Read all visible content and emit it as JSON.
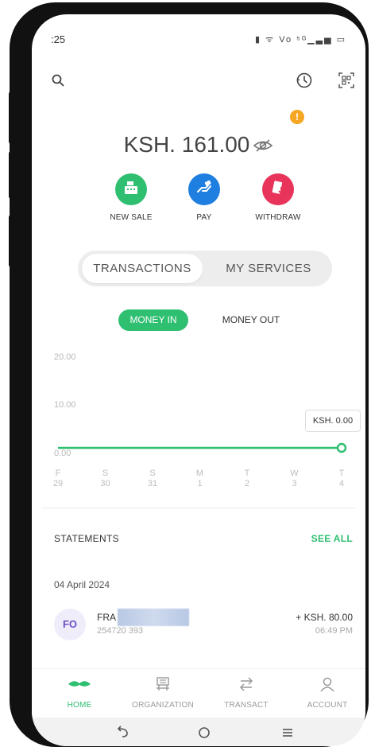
{
  "status_bar": {
    "time": ":25",
    "icons": "▮ ᯤ Vo ⁵ᴳ▁▃▅ ▭"
  },
  "header": {
    "search_icon": "search-icon",
    "history_icon": "history-icon",
    "scan_icon": "qr-scan-icon",
    "alert_glyph": "!"
  },
  "balance": {
    "amount": "KSH. 161.00",
    "visibility_icon": "eye-off-icon"
  },
  "actions": [
    {
      "label": "NEW SALE",
      "icon": "cash-register-icon",
      "color": "#2fbf71"
    },
    {
      "label": "PAY",
      "icon": "pay-hand-icon",
      "color": "#1f7fe0"
    },
    {
      "label": "WITHDRAW",
      "icon": "withdraw-icon",
      "color": "#e8345a"
    }
  ],
  "segment": {
    "tabs": [
      "TRANSACTIONS",
      "MY SERVICES"
    ],
    "active": "TRANSACTIONS"
  },
  "filter": {
    "options": [
      "MONEY IN",
      "MONEY OUT"
    ],
    "active": "MONEY IN"
  },
  "chart_data": {
    "type": "line",
    "categories": [
      "F 29",
      "S 30",
      "S 31",
      "M 1",
      "T 2",
      "W 3",
      "T 4"
    ],
    "day_letters": [
      "F",
      "S",
      "S",
      "M",
      "T",
      "W",
      "T"
    ],
    "day_numbers": [
      "29",
      "30",
      "31",
      "1",
      "2",
      "3",
      "4"
    ],
    "values": [
      0,
      0,
      0,
      0,
      0,
      0,
      0
    ],
    "y_ticks": [
      "20.00",
      "10.00",
      "0.00"
    ],
    "ylim": [
      0,
      20
    ],
    "grid": false,
    "tooltip": "KSH. 0.00",
    "line_color": "#2fbf71"
  },
  "statements": {
    "title": "STATEMENTS",
    "see_all": "SEE ALL",
    "date": "04 April 2024",
    "items": [
      {
        "initials": "FO",
        "name": "FRA",
        "sub": "254720   393",
        "amount": "+ KSH. 80.00",
        "time": "06:49 PM"
      }
    ]
  },
  "bottom_nav": [
    {
      "label": "HOME",
      "icon": "home-icon",
      "active": true
    },
    {
      "label": "ORGANIZATION",
      "icon": "organization-icon",
      "active": false
    },
    {
      "label": "TRANSACT",
      "icon": "transact-arrows-icon",
      "active": false
    },
    {
      "label": "ACCOUNT",
      "icon": "account-icon",
      "active": false
    }
  ],
  "colors": {
    "accent": "#2fbf71",
    "alert": "#f5a623"
  }
}
